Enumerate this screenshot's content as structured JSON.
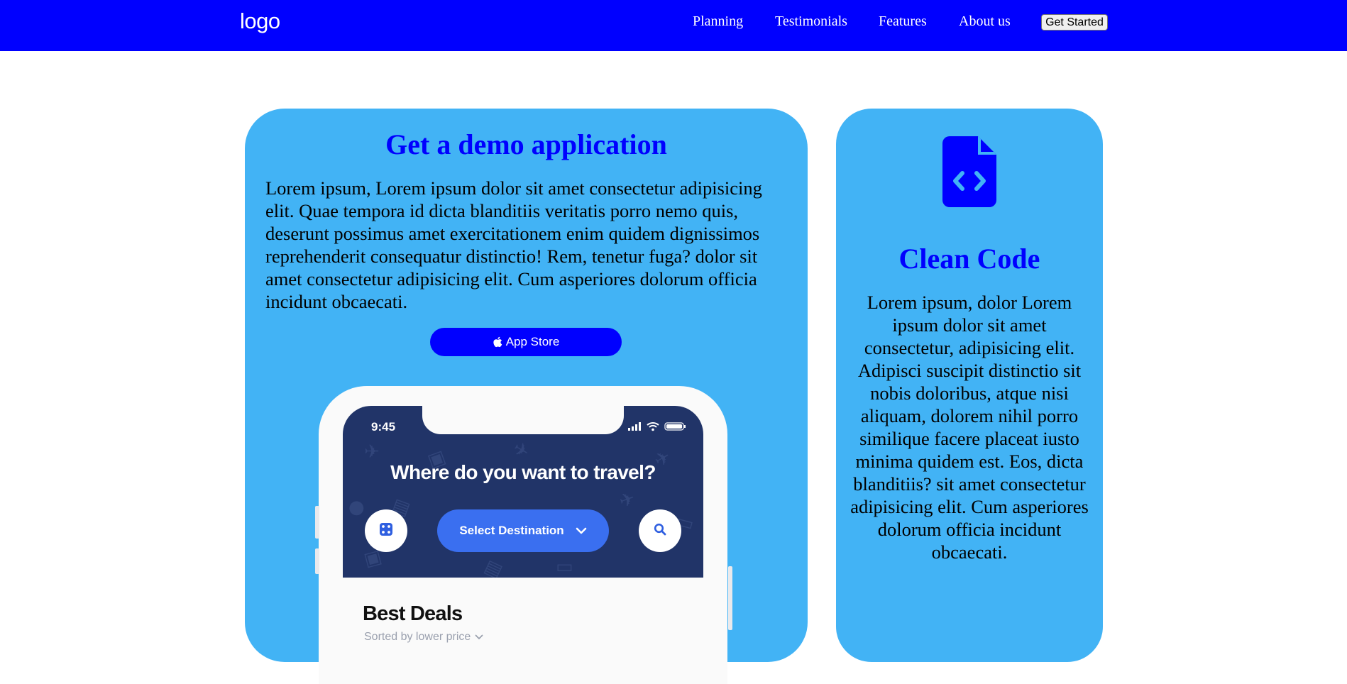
{
  "header": {
    "logo": "logo",
    "nav": [
      "Planning",
      "Testimonials",
      "Features",
      "About us"
    ],
    "cta": "Get Started",
    "background": "#0000ff"
  },
  "demo_card": {
    "title": "Get a demo application",
    "text": "Lorem ipsum, Lorem ipsum dolor sit amet consectetur adipisicing elit. Quae tempora id dicta blanditiis veritatis porro nemo quis, deserunt possimus amet exercitationem enim quidem dignissimos reprehenderit consequatur distinctio! Rem, tenetur fuga? dolor sit amet consectetur adipisicing elit. Cum asperiores dolorum officia incidunt obcaecati.",
    "store_button": "App Store",
    "store_icon": "apple-icon",
    "background": "#42b3f5",
    "phone": {
      "time": "9:45",
      "question": "Where do you want to travel?",
      "destination_button": "Select Destination",
      "section_title": "Best Deals",
      "sort_label": "Sorted by lower price"
    }
  },
  "code_card": {
    "icon": "file-code-icon",
    "title": "Clean Code",
    "text": "Lorem ipsum, dolor Lorem ipsum dolor sit amet consectetur, adipisicing elit. Adipisci suscipit distinctio sit nobis doloribus, atque nisi aliquam, dolorem nihil porro similique facere placeat iusto minima quidem est. Eos, dicta blanditiis? sit amet consectetur adipisicing elit. Cum asperiores dolorum officia incidunt obcaecati."
  }
}
